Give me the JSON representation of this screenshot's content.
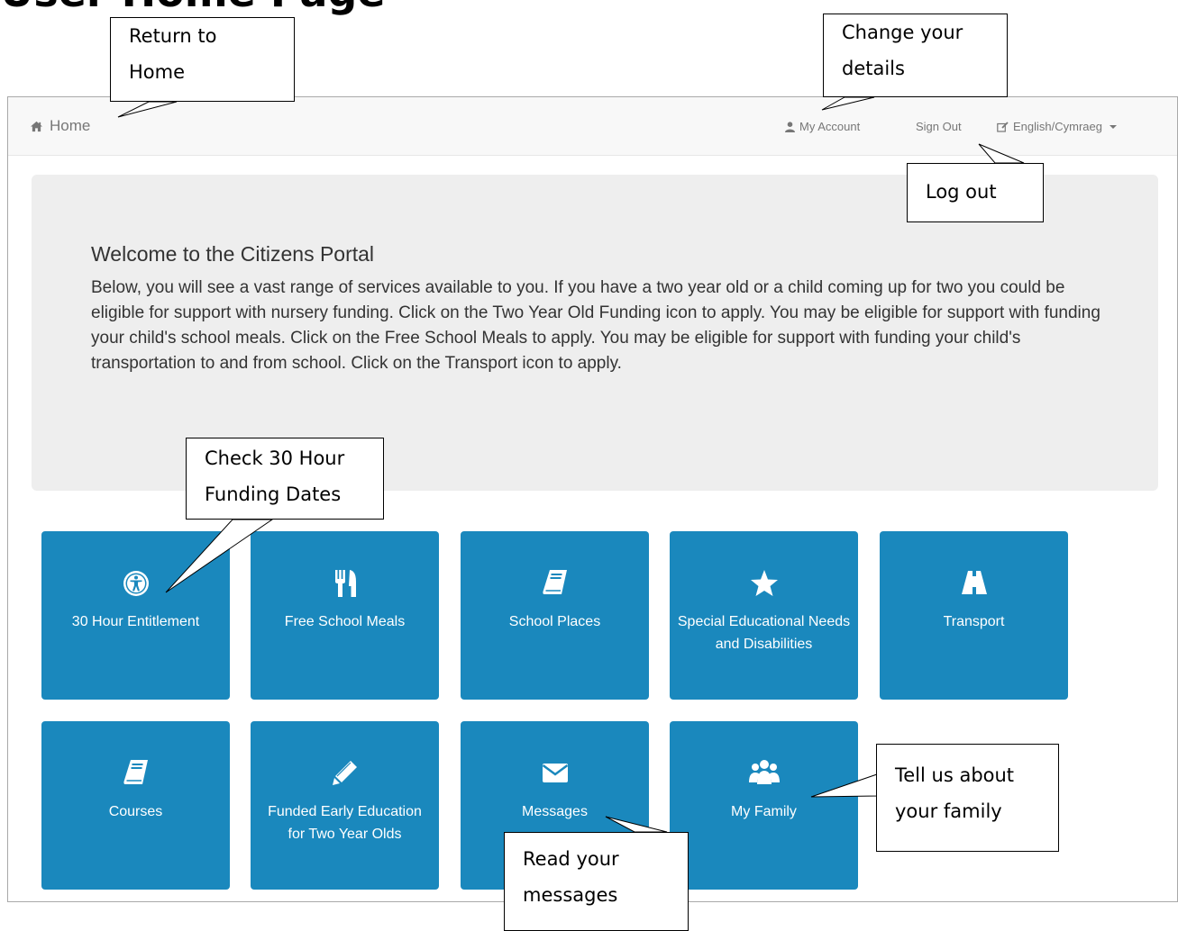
{
  "document": {
    "heading": "User Home Page"
  },
  "navbar": {
    "home": "Home",
    "my_account": "My Account",
    "sign_out": "Sign Out",
    "language": "English/Cymraeg",
    "icons": {
      "home": "home-icon",
      "account": "user-icon",
      "language": "edit-icon"
    }
  },
  "jumbotron": {
    "title": "Welcome to the Citizens Portal",
    "text": "Below, you will see a vast range of services available to you. If you have a two year old or a child coming up for two you could be eligible for support with nursery funding. Click on the Two Year Old Funding icon to apply. You may be eligible for support with funding your child's school meals. Click on the Free School Meals to apply. You may be eligible for support with funding your child's transportation to and from school. Click on the Transport icon to apply."
  },
  "tiles": [
    {
      "label": "30 Hour Entitlement",
      "icon": "accessibility-icon"
    },
    {
      "label": "Free School Meals",
      "icon": "cutlery-icon"
    },
    {
      "label": "School Places",
      "icon": "book-icon"
    },
    {
      "label": "Special Educational Needs and Disabilities",
      "icon": "star-icon"
    },
    {
      "label": "Transport",
      "icon": "road-icon"
    },
    {
      "label": "Courses",
      "icon": "book-icon"
    },
    {
      "label": "Funded Early Education for Two Year Olds",
      "icon": "pencil-icon"
    },
    {
      "label": "Messages",
      "icon": "envelope-icon"
    },
    {
      "label": "My Family",
      "icon": "users-icon"
    }
  ],
  "callouts": {
    "home": [
      "Return to",
      "Home"
    ],
    "details": [
      "Change your",
      "details"
    ],
    "logout": [
      "Log out"
    ],
    "funding": [
      "Check 30 Hour",
      "Funding Dates"
    ],
    "family": [
      "Tell us about",
      "your family"
    ],
    "messages": [
      "Read your",
      "messages"
    ]
  },
  "colors": {
    "tile": "#1a88bd",
    "jumbotron": "#eeeeee",
    "navbar": "#f8f8f8"
  }
}
